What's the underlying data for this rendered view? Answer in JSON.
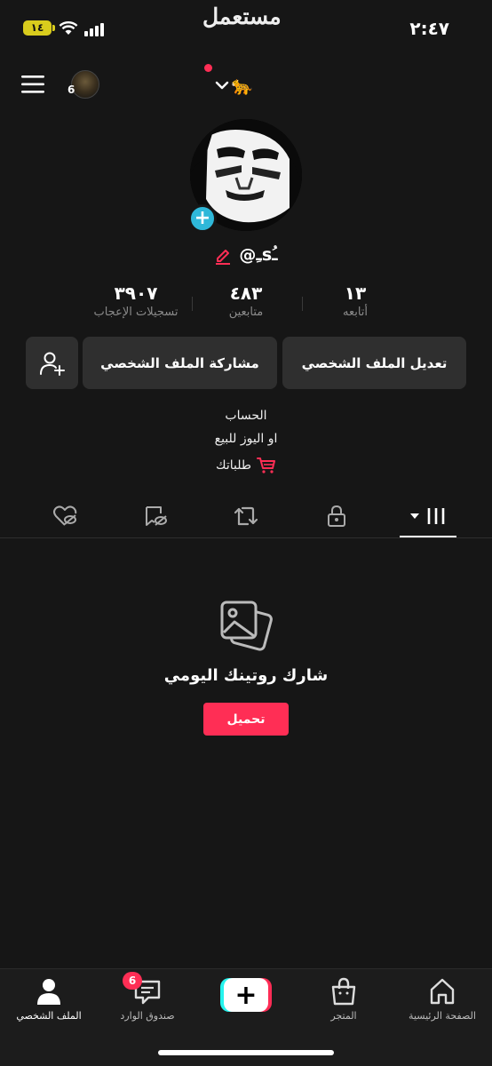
{
  "status_bar": {
    "time": "٢:٤٧",
    "battery": "١٤",
    "watermark": "مستعمل"
  },
  "top_nav": {
    "story_count": "6",
    "username_emoji": "🐆",
    "notification_dot_color": "#ff2e55"
  },
  "profile": {
    "handle": "@ـِsـُ",
    "stats": [
      {
        "value": "١٣",
        "label": "أتابعه"
      },
      {
        "value": "٤٨٣",
        "label": "متابعين"
      },
      {
        "value": "٣٩٠٧",
        "label": "تسجيلات الإعجاب"
      }
    ],
    "buttons": {
      "edit": "تعديل الملف الشخصي",
      "share": "مشاركة الملف الشخصي"
    },
    "bio_line1": "الحساب",
    "bio_line2": "او اليوز للبيع",
    "orders_label": "طلباتك"
  },
  "empty_state": {
    "title": "شارك روتينك اليومي",
    "button": "تحميل"
  },
  "bottom_nav": {
    "items": [
      {
        "label": "الصفحة الرئيسية",
        "icon": "home-icon"
      },
      {
        "label": "المتجر",
        "icon": "shop-icon"
      },
      {
        "label": "",
        "icon": "create-icon"
      },
      {
        "label": "صندوق الوارد",
        "icon": "inbox-icon"
      },
      {
        "label": "الملف الشخصي",
        "icon": "profile-icon"
      }
    ],
    "inbox_badge": "6"
  },
  "colors": {
    "accent": "#ff2e55",
    "add_avatar": "#2fb8d9",
    "background": "#161616"
  }
}
